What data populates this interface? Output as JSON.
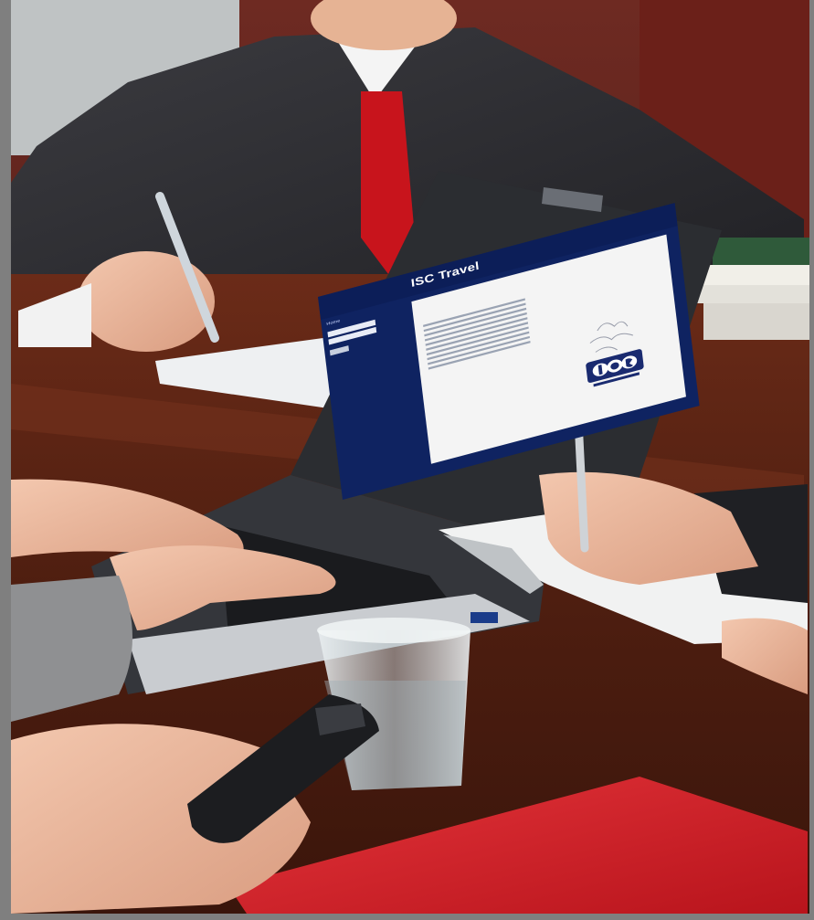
{
  "scene": {
    "description_tags": [
      "business-meeting",
      "laptop",
      "table"
    ]
  },
  "laptop": {
    "site": {
      "brand": "ISC Travel",
      "tagline": "",
      "nav": [
        "Home",
        "",
        "",
        "",
        "",
        "",
        ""
      ],
      "login_title": "",
      "content_title": "",
      "content_subtitle": ""
    }
  },
  "colors": {
    "screen_blue": "#0f2361",
    "tie_red": "#c8141c",
    "table_wood": "#5a2414",
    "folder_red": "#d8222a",
    "suit": "#2a2a2e"
  }
}
